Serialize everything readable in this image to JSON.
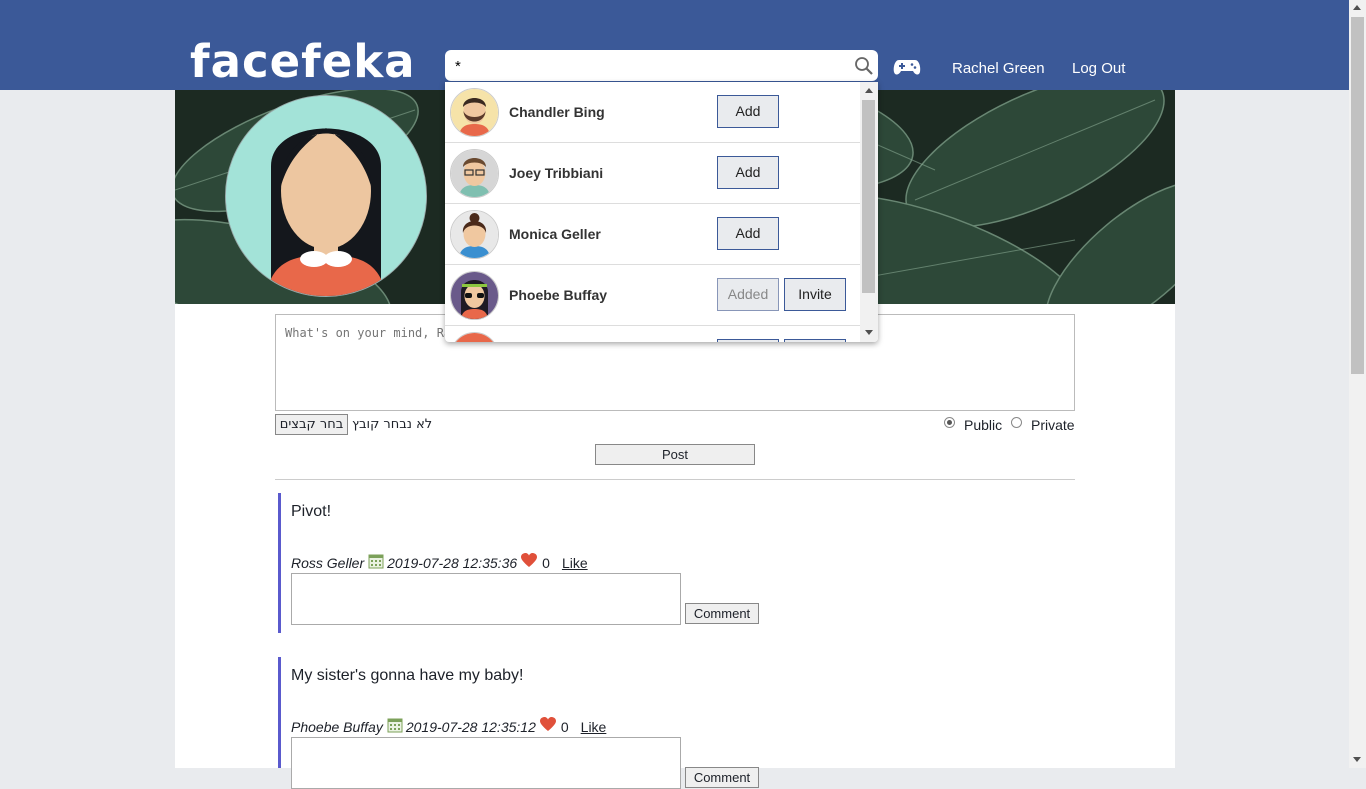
{
  "header": {
    "logo": "facefeka",
    "search_value": "*",
    "user_name": "Rachel Green",
    "logout_label": "Log Out"
  },
  "search_results": [
    {
      "name": "Chandler Bing",
      "primary_action": "Add"
    },
    {
      "name": "Joey Tribbiani",
      "primary_action": "Add"
    },
    {
      "name": "Monica Geller",
      "primary_action": "Add"
    },
    {
      "name": "Phoebe Buffay",
      "primary_action": "Added",
      "secondary_action": "Invite"
    }
  ],
  "composer": {
    "placeholder": "What's on your mind, Rachel?",
    "file_button": "בחר קבצים",
    "file_status": "לא נבחר קובץ",
    "visibility_options": [
      "Public",
      "Private"
    ],
    "visibility_selected": "Public",
    "post_label": "Post"
  },
  "posts": [
    {
      "text": "Pivot!",
      "author": "Ross Geller",
      "timestamp": "2019-07-28 12:35:36",
      "likes": "0",
      "like_label": "Like",
      "comment_label": "Comment"
    },
    {
      "text": "My sister's gonna have my baby!",
      "author": "Phoebe Buffay",
      "timestamp": "2019-07-28 12:35:12",
      "likes": "0",
      "like_label": "Like",
      "comment_label": "Comment"
    }
  ],
  "colors": {
    "brand": "#3b5998",
    "post_accent": "#5a5acd",
    "heart": "#e0503a"
  }
}
